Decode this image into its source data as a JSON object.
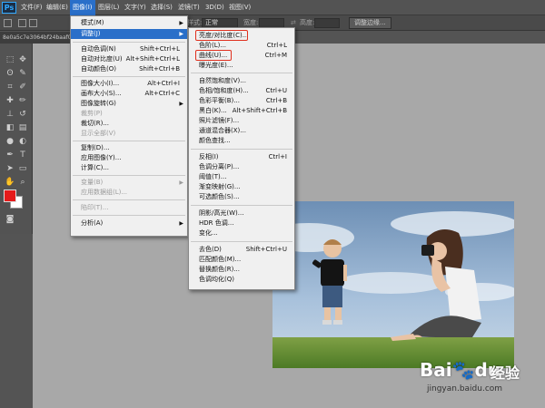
{
  "app": {
    "logo": "Ps"
  },
  "menubar": [
    {
      "label": "文件(F)"
    },
    {
      "label": "编辑(E)"
    },
    {
      "label": "图像(I)"
    },
    {
      "label": "图层(L)"
    },
    {
      "label": "文字(Y)"
    },
    {
      "label": "选择(S)"
    },
    {
      "label": "滤镜(T)"
    },
    {
      "label": "3D(D)"
    },
    {
      "label": "视图(V)"
    }
  ],
  "options": {
    "mode_label": "样式:",
    "mode_value": "正常",
    "width_label": "宽度:",
    "height_label": "高度:",
    "edge_button": "调整边缘..."
  },
  "document_tab": {
    "name": "8e0a5c7e3064bf24baaf0dfe"
  },
  "image_menu": [
    {
      "label": "模式(M)",
      "shortcut": "",
      "submenu": true,
      "disabled": false
    },
    {
      "label": "调整(J)",
      "shortcut": "",
      "submenu": true,
      "disabled": false,
      "highlighted": true
    },
    {
      "label": "自动色调(N)",
      "shortcut": "Shift+Ctrl+L",
      "disabled": false
    },
    {
      "label": "自动对比度(U)",
      "shortcut": "Alt+Shift+Ctrl+L",
      "disabled": false
    },
    {
      "label": "自动颜色(O)",
      "shortcut": "Shift+Ctrl+B",
      "disabled": false
    },
    {
      "label": "图像大小(I)...",
      "shortcut": "Alt+Ctrl+I",
      "disabled": false
    },
    {
      "label": "画布大小(S)...",
      "shortcut": "Alt+Ctrl+C",
      "disabled": false
    },
    {
      "label": "图像旋转(G)",
      "shortcut": "",
      "submenu": true,
      "disabled": false
    },
    {
      "label": "裁剪(P)",
      "shortcut": "",
      "disabled": true
    },
    {
      "label": "裁切(R)...",
      "shortcut": "",
      "disabled": false
    },
    {
      "label": "显示全部(V)",
      "shortcut": "",
      "disabled": true
    },
    {
      "label": "复制(D)...",
      "shortcut": "",
      "disabled": false
    },
    {
      "label": "应用图像(Y)...",
      "shortcut": "",
      "disabled": false
    },
    {
      "label": "计算(C)...",
      "shortcut": "",
      "disabled": false
    },
    {
      "label": "变量(B)",
      "shortcut": "",
      "submenu": true,
      "disabled": true
    },
    {
      "label": "应用数据组(L)...",
      "shortcut": "",
      "disabled": true
    },
    {
      "label": "陷印(T)...",
      "shortcut": "",
      "disabled": true
    },
    {
      "label": "分析(A)",
      "shortcut": "",
      "submenu": true,
      "disabled": false
    }
  ],
  "adjust_menu": [
    {
      "label": "亮度/对比度(C)...",
      "shortcut": "",
      "boxed": true
    },
    {
      "label": "色阶(L)...",
      "shortcut": "Ctrl+L"
    },
    {
      "label": "曲线(U)...",
      "shortcut": "Ctrl+M",
      "boxed": true
    },
    {
      "label": "曝光度(E)...",
      "shortcut": ""
    },
    {
      "label": "自然饱和度(V)...",
      "shortcut": ""
    },
    {
      "label": "色相/饱和度(H)...",
      "shortcut": "Ctrl+U"
    },
    {
      "label": "色彩平衡(B)...",
      "shortcut": "Ctrl+B"
    },
    {
      "label": "黑白(K)...",
      "shortcut": "Alt+Shift+Ctrl+B"
    },
    {
      "label": "照片滤镜(F)...",
      "shortcut": ""
    },
    {
      "label": "通道混合器(X)...",
      "shortcut": ""
    },
    {
      "label": "颜色查找...",
      "shortcut": ""
    },
    {
      "label": "反相(I)",
      "shortcut": "Ctrl+I"
    },
    {
      "label": "色调分离(P)...",
      "shortcut": ""
    },
    {
      "label": "阈值(T)...",
      "shortcut": ""
    },
    {
      "label": "渐变映射(G)...",
      "shortcut": ""
    },
    {
      "label": "可选颜色(S)...",
      "shortcut": ""
    },
    {
      "label": "阴影/高光(W)...",
      "shortcut": ""
    },
    {
      "label": "HDR 色调...",
      "shortcut": ""
    },
    {
      "label": "变化...",
      "shortcut": ""
    },
    {
      "label": "去色(D)",
      "shortcut": "Shift+Ctrl+U"
    },
    {
      "label": "匹配颜色(M)...",
      "shortcut": ""
    },
    {
      "label": "替换颜色(R)...",
      "shortcut": ""
    },
    {
      "label": "色调均化(Q)",
      "shortcut": ""
    }
  ],
  "colors": {
    "foreground": "#e51b1b",
    "background": "#ffffff",
    "highlight": "#2a6fc9"
  },
  "watermark": {
    "brand": "Bai",
    "brand2": "du",
    "cn": "经验",
    "url": "jingyan.baidu.com"
  }
}
